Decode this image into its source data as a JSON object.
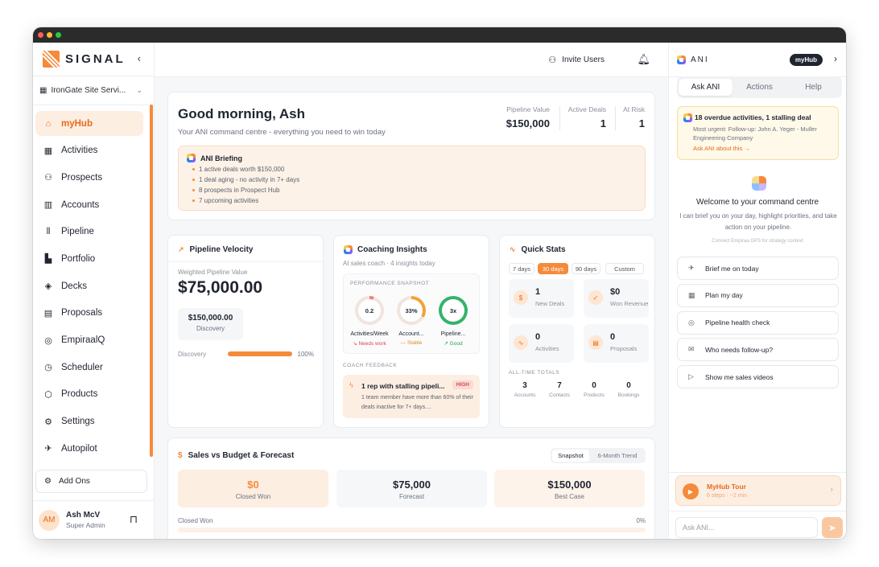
{
  "sidebar": {
    "brand": "SIGNAL",
    "org": "IronGate Site Servi...",
    "items": [
      {
        "label": "myHub",
        "icon": "home-icon"
      },
      {
        "label": "Activities",
        "icon": "calendar-icon"
      },
      {
        "label": "Prospects",
        "icon": "users-icon"
      },
      {
        "label": "Accounts",
        "icon": "building-icon"
      },
      {
        "label": "Pipeline",
        "icon": "pipeline-icon"
      },
      {
        "label": "Portfolio",
        "icon": "bar-chart-icon"
      },
      {
        "label": "Decks",
        "icon": "layers-icon"
      },
      {
        "label": "Proposals",
        "icon": "document-icon"
      },
      {
        "label": "EmpiraalQ",
        "icon": "compass-icon"
      },
      {
        "label": "Scheduler",
        "icon": "calendar-clock-icon"
      },
      {
        "label": "Products",
        "icon": "box-icon"
      },
      {
        "label": "Settings",
        "icon": "gear-icon"
      },
      {
        "label": "Autopilot",
        "icon": "rocket-icon"
      }
    ],
    "addons": "Add Ons",
    "user": {
      "initials": "AM",
      "name": "Ash McV",
      "role": "Super Admin"
    }
  },
  "topbar": {
    "invite": "Invite Users"
  },
  "header": {
    "greeting": "Good morning, Ash",
    "subtitle": "Your ANI command centre - everything you need to win today",
    "kpis": [
      {
        "label": "Pipeline Value",
        "value": "$150,000"
      },
      {
        "label": "Active Deals",
        "value": "1"
      },
      {
        "label": "At Risk",
        "value": "1"
      }
    ],
    "briefing": {
      "title": "ANI Briefing",
      "lines": [
        "1 active deals worth $150,000",
        "1 deal aging - no activity in 7+ days",
        "8 prospects in Prospect Hub",
        "7 upcoming activities"
      ]
    }
  },
  "velocity": {
    "title": "Pipeline Velocity",
    "label": "Weighted Pipeline Value",
    "value": "$75,000.00",
    "stage_value": "$150,000.00",
    "stage_name": "Discovery",
    "bar_label": "Discovery",
    "bar_pct_text": "100%",
    "bar_pct": 100
  },
  "coaching": {
    "title": "Coaching Insights",
    "subtitle": "AI sales coach · 4 insights today",
    "snapshot_title": "PERFORMANCE SNAPSHOT",
    "metrics": [
      {
        "value": "0.2",
        "label": "Activities/Week",
        "status": "↘ Needs work",
        "status_color": "#e04848",
        "ring_color": "#f07f7f",
        "pct": 5
      },
      {
        "value": "33%",
        "label": "Account...",
        "status": "— Stable",
        "status_color": "#e08a1e",
        "ring_color": "#f2a23a",
        "pct": 33
      },
      {
        "value": "3x",
        "label": "Pipeline...",
        "status": "↗ Good",
        "status_color": "#2aa05a",
        "ring_color": "#34b36a",
        "pct": 100
      }
    ],
    "feedback_title": "COACH FEEDBACK",
    "feedback": {
      "headline": "1 rep with stalling pipeli...",
      "badge": "HIGH",
      "text": "1 team member have more than 60% of their deals inactive for 7+ days...."
    }
  },
  "quick_stats": {
    "title": "Quick Stats",
    "ranges": [
      "7 days",
      "30 days",
      "90 days",
      "Custom"
    ],
    "active_range": "30 days",
    "stats": [
      {
        "value": "1",
        "label": "New Deals",
        "icon": "$"
      },
      {
        "value": "$0",
        "label": "Won Revenue",
        "icon": "✓"
      },
      {
        "value": "0",
        "label": "Activities",
        "icon": "∿"
      },
      {
        "value": "0",
        "label": "Proposals",
        "icon": "▤"
      }
    ],
    "totals_title": "ALL-TIME TOTALS",
    "totals": [
      {
        "value": "3",
        "label": "Accounts"
      },
      {
        "value": "7",
        "label": "Contacts"
      },
      {
        "value": "0",
        "label": "Products"
      },
      {
        "value": "0",
        "label": "Bookings"
      }
    ]
  },
  "budget": {
    "title": "Sales vs Budget & Forecast",
    "toggles": [
      "Snapshot",
      "6-Month Trend"
    ],
    "boxes": [
      {
        "value": "$0",
        "label": "Closed Won"
      },
      {
        "value": "$75,000",
        "label": "Forecast"
      },
      {
        "value": "$150,000",
        "label": "Best Case"
      }
    ],
    "progress_label": "Closed Won",
    "progress_pct": "0%"
  },
  "right_panel": {
    "brand": "ANI",
    "badge": "myHub",
    "tabs": [
      "Ask ANI",
      "Actions",
      "Help"
    ],
    "alert": {
      "title": "18 overdue activities, 1 stalling deal",
      "text": "Most urgent: Follow-up: John A. Yeger - Muller Engineering Company",
      "link": "Ask ANI about this →"
    },
    "welcome_title": "Welcome to your command centre",
    "welcome_text": "I can brief you on your day, highlight priorities, and take action on your pipeline.",
    "connect": "Connect Empiraa GPS for strategy context",
    "actions": [
      {
        "label": "Brief me on today",
        "icon": "rocket-icon"
      },
      {
        "label": "Plan my day",
        "icon": "calendar-icon"
      },
      {
        "label": "Pipeline health check",
        "icon": "target-icon"
      },
      {
        "label": "Who needs follow-up?",
        "icon": "mail-icon"
      },
      {
        "label": "Show me sales videos",
        "icon": "play-icon"
      }
    ],
    "tour": {
      "title": "MyHub Tour",
      "sub": "6 steps · ~2 min"
    },
    "input_placeholder": "Ask ANI..."
  },
  "colors": {
    "accent": "#f58a3b",
    "accent_light": "#fdeee2",
    "alert_bg": "#fef9e8"
  }
}
